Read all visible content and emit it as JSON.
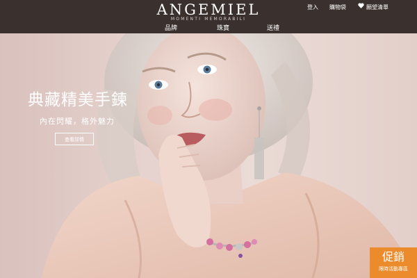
{
  "header": {
    "logo": "ANGEMIEL",
    "tagline": "MOMENTI MEMORABILI",
    "utility": {
      "login": "登入",
      "cart": "購物袋",
      "wishlist": "願望清單"
    },
    "nav": [
      "品牌",
      "珠寶",
      "送禮"
    ]
  },
  "hero": {
    "headline": "典藏精美手鍊",
    "subline": "內在閃耀，格外魅力",
    "cta": "查看詳情"
  },
  "promo": {
    "title": "促銷",
    "subtitle": "限時活動專區"
  },
  "colors": {
    "header_bg": "#3a302d",
    "promo_bg": "#ec8b2b",
    "hero_bg": "#e5d3d0"
  },
  "icons": {
    "wishlist": "heart-icon"
  }
}
